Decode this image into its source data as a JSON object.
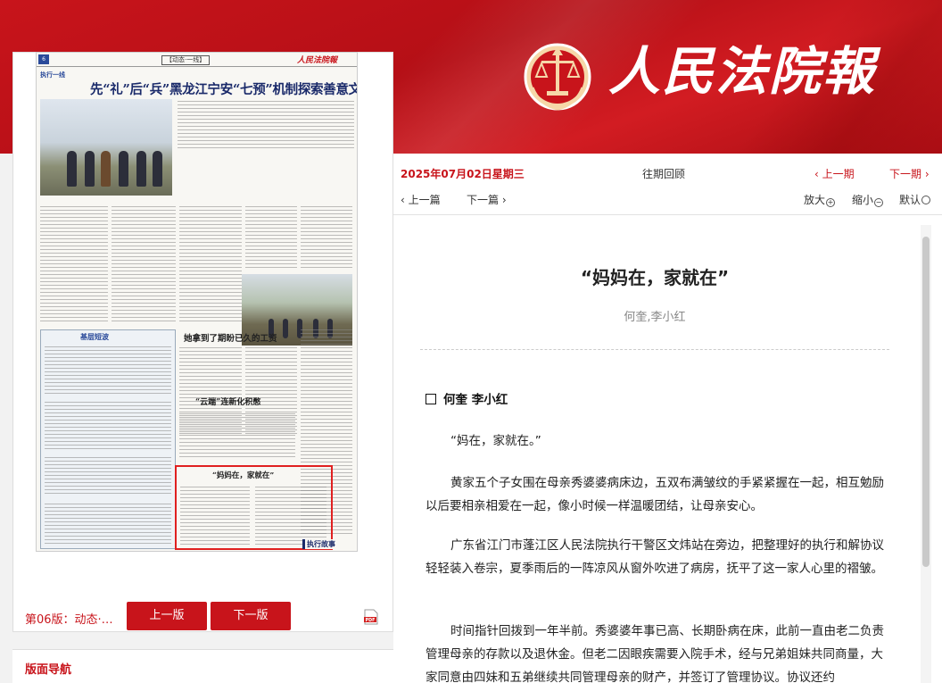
{
  "header": {
    "logo_text": "人民法院報"
  },
  "newspaper": {
    "page_no": "6",
    "section": "【动态·一线】",
    "masthead": "人民法院報",
    "kicker": "执行一线",
    "headline": "先“礼”后“兵”黑龙江宁安“七预”机制探索善意文明执行",
    "sub1": "她拿到了期盼已久的工资",
    "sub2": "“云端”连新化积憋",
    "sub3": "“妈妈在，家就在”",
    "box_title": "基层短波",
    "tag": "执行故事"
  },
  "left_footer": {
    "page_label": "第06版：动态·…",
    "prev_button": "上一版",
    "next_button": "下一版",
    "pdf_label": "PDF"
  },
  "nav_panel": {
    "title": "版面导航"
  },
  "date_bar": {
    "date": "2025年07月02日星期三",
    "past": "往期回顾",
    "prev_issue": "‹ 上一期",
    "next_issue": "下一期 ›"
  },
  "tool_bar": {
    "prev_article": "‹ 上一篇",
    "next_article": "下一篇 ›",
    "zoom_in": "放大",
    "zoom_out": "缩小",
    "default": "默认"
  },
  "article": {
    "title": "“妈妈在，家就在”",
    "author": "何奎,李小红",
    "byline": "何奎  李小红",
    "paragraphs": [
      "“妈在，家就在。”",
      "黄家五个子女围在母亲秀婆婆病床边，五双布满皱纹的手紧紧握在一起，相互勉励以后要相亲相爱在一起，像小时候一样温暖团结，让母亲安心。",
      "广东省江门市蓬江区人民法院执行干警区文炜站在旁边，把整理好的执行和解协议轻轻装入卷宗，夏季雨后的一阵凉风从窗外吹进了病房，抚平了这一家人心里的褶皱。",
      "时间指针回拨到一年半前。秀婆婆年事已高、长期卧病在床，此前一直由老二负责管理母亲的存款以及退休金。但老二因眼疾需要入院手术，经与兄弟姐妹共同商量，大家同意由四妹和五弟继续共同管理母亲的财产，并签订了管理协议。协议还约"
    ]
  },
  "colors": {
    "brand_red": "#c8141b",
    "headline_blue": "#1a2a6a"
  }
}
